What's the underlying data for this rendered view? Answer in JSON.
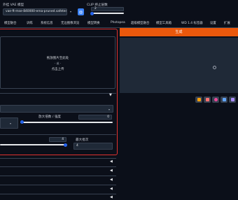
{
  "header": {
    "vae_label": "外挂 VAE 模型",
    "model_value": "vae-ft-mse-840000-ema-pruned.safetensors",
    "clip_label": "CLIP 终止层数",
    "clip_value": "2",
    "clip_level": 0.05
  },
  "tabs": [
    "模型融合",
    "训练",
    "系统信息",
    "无边图像浏览",
    "模型转换",
    "Photopea",
    "超级模型融合",
    "模型工具箱",
    "WD 1.4 标签器",
    "设置",
    "扩展"
  ],
  "generate_label": "生成",
  "upload": {
    "line1": "拖放图片至此处",
    "line2": "- 或 -",
    "line3": "点击上传"
  },
  "params": {
    "scale_label": "放大倍数 / 强度",
    "scale_value": "0",
    "scale_level": 0.0,
    "slider2_value": "4",
    "slider2_level": 1.0,
    "batch_label": "最大批次",
    "batch_value": "4"
  },
  "icons": [
    "folder-icon",
    "image-icon",
    "palette-icon",
    "chart-icon",
    "zip-icon"
  ],
  "colors": {
    "accent": "#ea580c",
    "slider": "#2563eb",
    "frame": "#e0322f",
    "background": "#0b0f19"
  }
}
